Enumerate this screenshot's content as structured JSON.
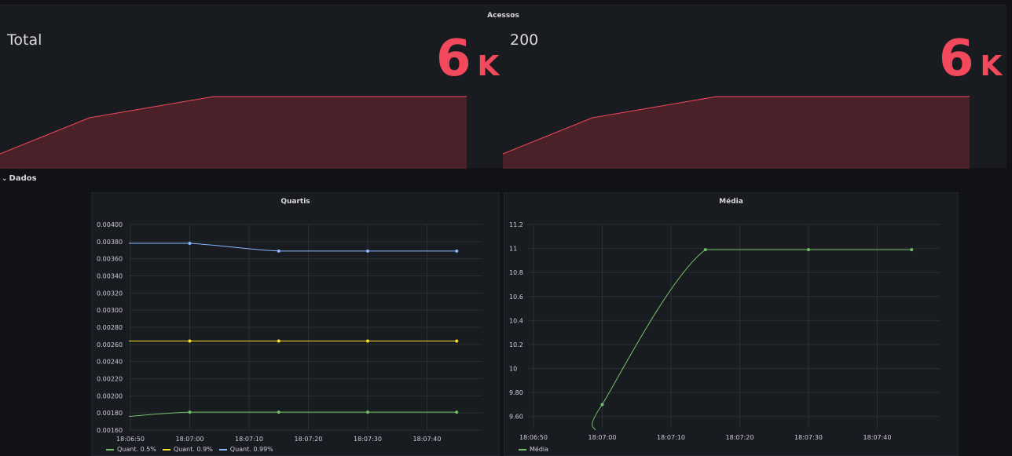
{
  "top": {
    "title": "Acessos",
    "stats": [
      {
        "label": "Total",
        "value": "6",
        "unit": "K",
        "color": "#f2495c"
      },
      {
        "label": "200",
        "value": "6",
        "unit": "K",
        "color": "#f2495c"
      }
    ]
  },
  "row": {
    "title": "Dados",
    "chevron": "chevron-down-icon"
  },
  "panels": {
    "quartis": {
      "title": "Quartis"
    },
    "media": {
      "title": "Média"
    }
  },
  "chart_data": [
    {
      "type": "line",
      "title": "Quartis",
      "x": [
        "18:06:50",
        "18:07:00",
        "18:07:10",
        "18:07:20",
        "18:07:30",
        "18:07:40"
      ],
      "ylim": [
        0.0016,
        0.004
      ],
      "yticks": [
        "0.00400",
        "0.00380",
        "0.00360",
        "0.00340",
        "0.00320",
        "0.00300",
        "0.00280",
        "0.00260",
        "0.00240",
        "0.00220",
        "0.00200",
        "0.00180",
        "0.00160"
      ],
      "series": [
        {
          "name": "Quant. 0.5%",
          "color": "#73bf69",
          "points": [
            [
              "18:06:48",
              0.00175
            ],
            [
              "18:07:00",
              0.00181
            ],
            [
              "18:07:15",
              0.00181
            ],
            [
              "18:07:30",
              0.00181
            ],
            [
              "18:07:45",
              0.00181
            ]
          ]
        },
        {
          "name": "Quant. 0.9%",
          "color": "#fade2a",
          "points": [
            [
              "18:06:48",
              0.00264
            ],
            [
              "18:07:00",
              0.00264
            ],
            [
              "18:07:15",
              0.00264
            ],
            [
              "18:07:30",
              0.00264
            ],
            [
              "18:07:45",
              0.00264
            ]
          ]
        },
        {
          "name": "Quant. 0.99%",
          "color": "#8ab8ff",
          "points": [
            [
              "18:06:48",
              0.00378
            ],
            [
              "18:07:00",
              0.00378
            ],
            [
              "18:07:15",
              0.00369
            ],
            [
              "18:07:30",
              0.00369
            ],
            [
              "18:07:45",
              0.00369
            ]
          ]
        }
      ]
    },
    {
      "type": "line",
      "title": "Média",
      "x": [
        "18:06:50",
        "18:07:00",
        "18:07:10",
        "18:07:20",
        "18:07:30",
        "18:07:40"
      ],
      "ylim": [
        9.5,
        11.2
      ],
      "yticks": [
        "11.2",
        "11",
        "10.8",
        "10.6",
        "10.4",
        "10.2",
        "10",
        "9.80",
        "9.60"
      ],
      "series": [
        {
          "name": "Média",
          "color": "#73bf69",
          "points": [
            [
              "18:06:59",
              9.48
            ],
            [
              "18:07:00",
              9.7
            ],
            [
              "18:07:15",
              10.99
            ],
            [
              "18:07:30",
              10.99
            ],
            [
              "18:07:45",
              10.99
            ]
          ]
        }
      ]
    }
  ]
}
